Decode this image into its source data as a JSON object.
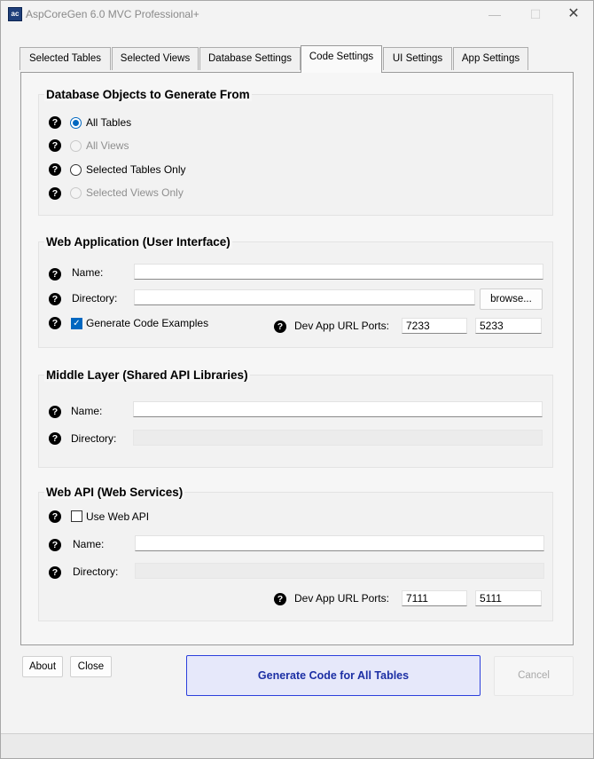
{
  "window": {
    "title": "AspCoreGen 6.0 MVC Professional+",
    "icon_text": "ac"
  },
  "tabs": [
    {
      "label": "Selected Tables"
    },
    {
      "label": "Selected Views"
    },
    {
      "label": "Database Settings"
    },
    {
      "label": "Code Settings"
    },
    {
      "label": "UI Settings"
    },
    {
      "label": "App Settings"
    }
  ],
  "active_tab": "Code Settings",
  "db_objects": {
    "title": "Database Objects to Generate From",
    "options": [
      {
        "label": "All Tables",
        "checked": true,
        "disabled": false
      },
      {
        "label": "All Views",
        "checked": false,
        "disabled": true
      },
      {
        "label": "Selected Tables Only",
        "checked": false,
        "disabled": false
      },
      {
        "label": "Selected Views Only",
        "checked": false,
        "disabled": true
      }
    ]
  },
  "web_app": {
    "title": "Web Application (User Interface)",
    "name_label": "Name:",
    "name_value": "",
    "directory_label": "Directory:",
    "directory_value": "",
    "browse_label": "browse...",
    "generate_examples_label": "Generate Code Examples",
    "generate_examples_checked": true,
    "ports_label": "Dev App URL Ports:",
    "port_https": "7233",
    "port_http": "5233"
  },
  "middle_layer": {
    "title": "Middle Layer (Shared API Libraries)",
    "name_label": "Name:",
    "name_value": "",
    "directory_label": "Directory:",
    "directory_value": ""
  },
  "web_api": {
    "title": "Web API (Web Services)",
    "use_label": "Use Web API",
    "use_checked": false,
    "name_label": "Name:",
    "name_value": "",
    "directory_label": "Directory:",
    "directory_value": "",
    "ports_label": "Dev App URL Ports:",
    "port_https": "7111",
    "port_http": "5111"
  },
  "footer": {
    "about_label": "About",
    "close_label": "Close",
    "generate_label": "Generate Code for All Tables",
    "cancel_label": "Cancel"
  },
  "colors": {
    "accent": "#0067c0",
    "primary_border": "#2c3fdc",
    "primary_bg": "#e6e8fa"
  },
  "help_icon_glyph": "?"
}
